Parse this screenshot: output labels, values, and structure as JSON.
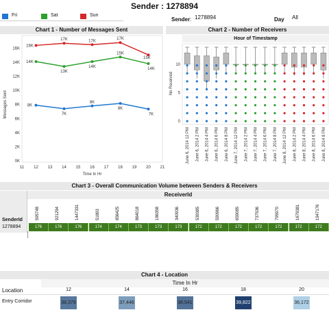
{
  "header": {
    "title": "Sender : 1278894",
    "sender_label": "Sender",
    "sender_value": "1278894",
    "day_label": "Day",
    "day_value": "All"
  },
  "legend": [
    {
      "name": "Fri",
      "color": "#1f77d0"
    },
    {
      "name": "Sat",
      "color": "#2ca02c"
    },
    {
      "name": "Sun",
      "color": "#d62728"
    }
  ],
  "chart1": {
    "title": "Chart 1 - Number of Messages Sent"
  },
  "chart2": {
    "title": "Chart 2 - Number of Receivers",
    "subtitle": "Hour of Timestamp",
    "ylabel": "No Received",
    "yticks": [
      "0",
      "5",
      "10"
    ]
  },
  "chart3": {
    "title": "Chart 3 - Overall Communication Volume between Senders & Receivers",
    "col_header": "ReceiverId",
    "row_header": "SenderId",
    "sender": "1278894"
  },
  "chart4": {
    "title": "Chart 4 - Location",
    "col_header": "Time In Hr",
    "row_header": "Location",
    "row_label": "Entry Corridor"
  },
  "chart_data": [
    {
      "type": "line",
      "title": "Chart 1 - Number of Messages Sent",
      "xlabel": "Time In Hr",
      "ylabel": "Messages Sent",
      "x": [
        12,
        14,
        16,
        18,
        20
      ],
      "xticks": [
        "11",
        "12",
        "13",
        "14",
        "15",
        "16",
        "17",
        "18",
        "19",
        "20",
        "21"
      ],
      "yticks": [
        "0K",
        "2K",
        "4K",
        "6K",
        "8K",
        "10K",
        "12K",
        "14K",
        "16K"
      ],
      "ylim": [
        0,
        17500
      ],
      "series": [
        {
          "name": "Fri",
          "color": "#1f77d0",
          "values": [
            7900,
            7400,
            7800,
            8150,
            7350
          ],
          "labels": [
            "8K",
            "7K",
            "8K",
            "8K",
            "7K"
          ]
        },
        {
          "name": "Sat",
          "color": "#2ca02c",
          "values": [
            14100,
            13400,
            14100,
            14750,
            13800
          ],
          "labels": [
            "14K",
            "13K",
            "14K",
            "15K",
            "14K"
          ]
        },
        {
          "name": "Sun",
          "color": "#d62728",
          "values": [
            16400,
            16700,
            16500,
            16800,
            15050
          ],
          "labels": [
            "16K",
            "17K",
            "17K",
            "17K",
            "15K"
          ]
        }
      ]
    },
    {
      "type": "box",
      "title": "Chart 2 - Number of Receivers",
      "xlabel": "Hour of Timestamp",
      "ylabel": "No Received",
      "ylim": [
        0,
        13
      ],
      "categories": [
        "June 6, 2014 12 PM",
        "June 6, 2014 2 PM",
        "June 6, 2014 4 PM",
        "June 6, 2014 6 PM",
        "June 6, 2014 8 PM",
        "June 7, 2014 12 PM",
        "June 7, 2014 2 PM",
        "June 7, 2014 4 PM",
        "June 7, 2014 6 PM",
        "June 7, 2014 8 PM",
        "June 8, 2014 12 PM",
        "June 8, 2014 2 PM",
        "June 8, 2014 4 PM",
        "June 8, 2014 6 PM",
        "June 8, 2014 8 PM"
      ],
      "colors": [
        "#1f77d0",
        "#1f77d0",
        "#1f77d0",
        "#1f77d0",
        "#1f77d0",
        "#2ca02c",
        "#2ca02c",
        "#2ca02c",
        "#2ca02c",
        "#2ca02c",
        "#d62728",
        "#d62728",
        "#d62728",
        "#d62728",
        "#d62728"
      ]
    },
    {
      "type": "table",
      "title": "Chart 3 - Overall Communication Volume between Senders & Receivers",
      "columns": [
        "595748",
        "921294",
        "1447331",
        "51893",
        "856425",
        "864018",
        "186358",
        "340936",
        "539385",
        "590966",
        "659085",
        "737536",
        "795970",
        "1679381",
        "1947176"
      ],
      "values": [
        176,
        176,
        176,
        174,
        174,
        173,
        173,
        173,
        172,
        172,
        172,
        172,
        172,
        172,
        172
      ]
    },
    {
      "type": "heatmap",
      "title": "Chart 4 - Location",
      "columns": [
        "12",
        "14",
        "16",
        "18",
        "20"
      ],
      "rows": [
        "Entry Corridor"
      ],
      "values": [
        [
          38379,
          37446,
          38541,
          39822,
          36172
        ]
      ],
      "labels": [
        "38,379",
        "37,446",
        "38,541",
        "39,822",
        "36,172"
      ]
    }
  ]
}
